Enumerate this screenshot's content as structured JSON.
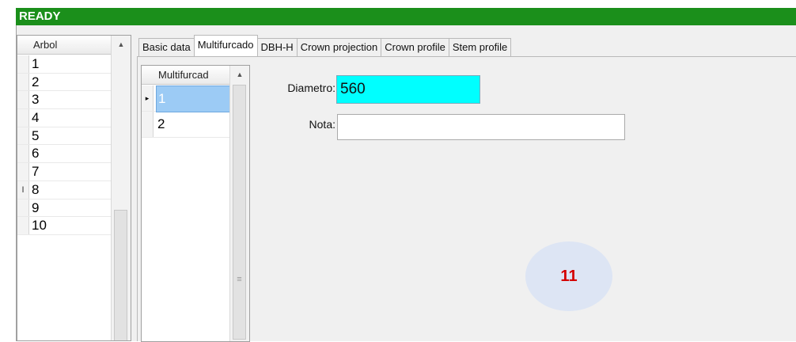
{
  "status": "READY",
  "arbol": {
    "header": "Arbol",
    "rows": [
      {
        "value": "1",
        "marker": ""
      },
      {
        "value": "2",
        "marker": ""
      },
      {
        "value": "3",
        "marker": ""
      },
      {
        "value": "4",
        "marker": ""
      },
      {
        "value": "5",
        "marker": ""
      },
      {
        "value": "6",
        "marker": ""
      },
      {
        "value": "7",
        "marker": ""
      },
      {
        "value": "8",
        "marker": "I"
      },
      {
        "value": "9",
        "marker": ""
      },
      {
        "value": "10",
        "marker": ""
      }
    ]
  },
  "tabs": [
    {
      "label": "Basic data",
      "active": false
    },
    {
      "label": "Multifurcado",
      "active": true
    },
    {
      "label": "DBH-H",
      "active": false
    },
    {
      "label": "Crown projection",
      "active": false
    },
    {
      "label": "Crown profile",
      "active": false
    },
    {
      "label": "Stem profile",
      "active": false
    }
  ],
  "multifurcado": {
    "header": "Multifurcad",
    "rows": [
      {
        "value": "1",
        "selected": true,
        "marker": "▸"
      },
      {
        "value": "2",
        "selected": false,
        "marker": ""
      }
    ]
  },
  "form": {
    "diametro_label": "Diametro:",
    "diametro_value": "560",
    "nota_label": "Nota:",
    "nota_value": ""
  },
  "badge": "11",
  "colors": {
    "status_bar": "#1b8f1b",
    "diametro_bg": "#00ffff",
    "selected_row": "#9ccbf5",
    "badge_text": "#d40000"
  },
  "icons": {
    "scroll_up": "up-arrow-icon",
    "row_pointer": "row-pointer-icon"
  }
}
